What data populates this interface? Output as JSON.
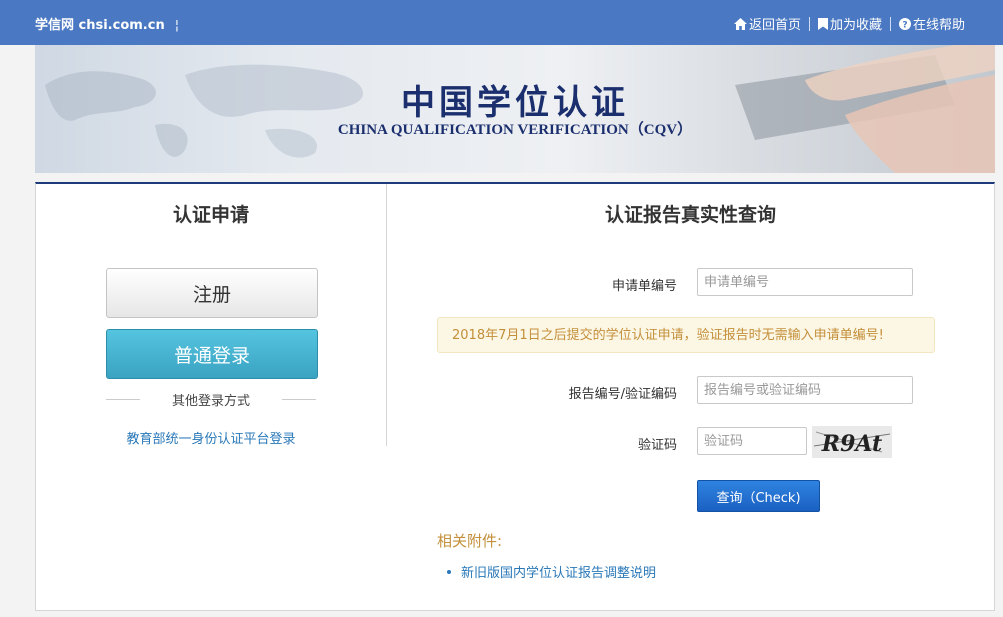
{
  "topbar": {
    "site": "学信网 chsi.com.cn",
    "nav": [
      {
        "icon": "home-icon",
        "label": "返回首页"
      },
      {
        "icon": "bookmark-icon",
        "label": "加为收藏"
      },
      {
        "icon": "help-icon",
        "label": "在线帮助"
      }
    ]
  },
  "banner": {
    "title": "中国学位认证",
    "subtitle": "CHINA QUALIFICATION VERIFICATION（CQV）"
  },
  "left": {
    "title": "认证申请",
    "register_label": "注册",
    "login_label": "普通登录",
    "other_login_label": "其他登录方式",
    "edu_login_link": "教育部统一身份认证平台登录"
  },
  "right": {
    "title": "认证报告真实性查询",
    "app_no_label": "申请单编号",
    "app_no_placeholder": "申请单编号",
    "notice": "2018年7月1日之后提交的学位认证申请，验证报告时无需输入申请单编号!",
    "report_no_label": "报告编号/验证编码",
    "report_no_placeholder": "报告编号或验证编码",
    "captcha_label": "验证码",
    "captcha_placeholder": "验证码",
    "captcha_text": "R9At",
    "check_button": "查询（Check)",
    "attachments_title": "相关附件:",
    "attachments": [
      "新旧版国内学位认证报告调整说明"
    ]
  },
  "colors": {
    "topbar": "#4a78c2",
    "login_button": "#3aa3c2",
    "check_button": "#1a60c2",
    "link": "#2a78b8",
    "notice_text": "#c38f3a"
  }
}
